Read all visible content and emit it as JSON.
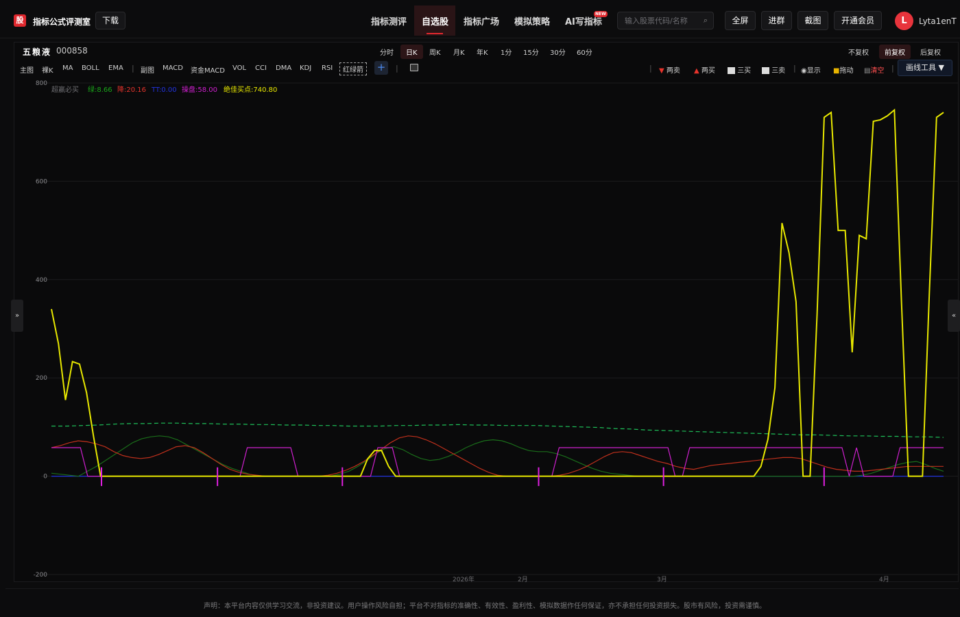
{
  "header": {
    "logo_text": "股",
    "app_name": "指标公式评测室",
    "download_label": "下载",
    "nav": [
      {
        "label": "指标测评",
        "active": false
      },
      {
        "label": "自选股",
        "active": true
      },
      {
        "label": "指标广场",
        "active": false
      },
      {
        "label": "模拟策略",
        "active": false
      },
      {
        "label": "AI写指标",
        "active": false,
        "badge": "NEW"
      }
    ],
    "search_placeholder": "输入股票代码/名称",
    "fullscreen_label": "全屏",
    "join_group_label": "进群",
    "screenshot_label": "截图",
    "vip_label": "开通会员",
    "avatar_letter": "L",
    "username": "Lyta1enT"
  },
  "stock": {
    "name": "五粮液",
    "code": "000858"
  },
  "periods": [
    "分时",
    "日K",
    "周K",
    "月K",
    "年K",
    "1分",
    "15分",
    "30分",
    "60分"
  ],
  "selected_period": "日K",
  "adjust": [
    "不复权",
    "前复权",
    "后复权"
  ],
  "selected_adjust": "前复权",
  "indicators_main": [
    "主图",
    "裸K",
    "MA",
    "BOLL",
    "EMA"
  ],
  "indicators_sub": [
    "副图",
    "MACD",
    "资金MACD",
    "VOL",
    "CCI",
    "DMA",
    "KDJ",
    "RSI",
    "红绿箭"
  ],
  "tools": [
    {
      "label": "两卖",
      "icon": "down-triangle-icon",
      "color": "#e8342c"
    },
    {
      "label": "两买",
      "icon": "up-triangle-icon",
      "color": "#e8342c"
    },
    {
      "label": "三买",
      "icon": "trend-up-icon",
      "color": "#cfcfcf"
    },
    {
      "label": "三卖",
      "icon": "trend-down-icon",
      "color": "#cfcfcf"
    },
    {
      "label": "显示",
      "icon": "eye-icon",
      "color": "#cfcfcf"
    },
    {
      "label": "拖动",
      "icon": "lock-icon",
      "color": "#cfcfcf"
    },
    {
      "label": "清空",
      "icon": "trash-icon",
      "color": "#ff5050"
    }
  ],
  "draw_tools_label": "画线工具 ▼",
  "legend": [
    {
      "label": "超赢必买",
      "color": "#6e6e72"
    },
    {
      "label": "绿:8.66",
      "color": "#1aa81a"
    },
    {
      "label": "降:20.16",
      "color": "#e8342c"
    },
    {
      "label": "TT:0.00",
      "color": "#2233dd"
    },
    {
      "label": "操盘:58.00",
      "color": "#d020d0"
    },
    {
      "label": "绝佳买点:740.80",
      "color": "#e8e800"
    }
  ],
  "chart_data": {
    "type": "line",
    "y_ticks": [
      800,
      600,
      400,
      200,
      0,
      -200
    ],
    "ylim": [
      -200,
      800
    ],
    "x_labels": [
      "2026年",
      "2月",
      "3月",
      "4月"
    ],
    "grid": true,
    "series": [
      {
        "name": "绝佳买点",
        "color": "#e8e800",
        "values": [
          340,
          270,
          155,
          233,
          228,
          170,
          80,
          0,
          0,
          0,
          0,
          0,
          0,
          0,
          0,
          0,
          0,
          0,
          0,
          0,
          0,
          0,
          0,
          0,
          0,
          0,
          0,
          0,
          0,
          0,
          0,
          0,
          0,
          0,
          0,
          0,
          0,
          0,
          0,
          0,
          0,
          0,
          0,
          0,
          0,
          35,
          52,
          52,
          20,
          0,
          0,
          0,
          0,
          0,
          0,
          0,
          0,
          0,
          0,
          0,
          0,
          0,
          0,
          0,
          0,
          0,
          0,
          0,
          0,
          0,
          0,
          0,
          0,
          0,
          0,
          0,
          0,
          0,
          0,
          0,
          0,
          0,
          0,
          0,
          0,
          0,
          0,
          0,
          0,
          0,
          0,
          0,
          0,
          0,
          0,
          0,
          0,
          0,
          0,
          0,
          0,
          20,
          75,
          180,
          515,
          455,
          355,
          0,
          0,
          330,
          730,
          740,
          500,
          500,
          252,
          490,
          483,
          722,
          725,
          733,
          745,
          360,
          0,
          0,
          0,
          380,
          730,
          740
        ]
      },
      {
        "name": "操盘",
        "color": "#d020d0",
        "values": [
          58,
          58,
          58,
          58,
          58,
          0,
          0,
          0,
          0,
          0,
          0,
          0,
          0,
          0,
          0,
          0,
          0,
          0,
          0,
          0,
          0,
          0,
          0,
          0,
          0,
          0,
          0,
          58,
          58,
          58,
          58,
          58,
          58,
          58,
          0,
          0,
          0,
          0,
          0,
          0,
          0,
          0,
          0,
          0,
          0,
          58,
          58,
          58,
          0,
          0,
          0,
          0,
          0,
          0,
          0,
          0,
          0,
          0,
          0,
          0,
          0,
          0,
          0,
          0,
          0,
          0,
          0,
          0,
          0,
          0,
          58,
          58,
          58,
          58,
          58,
          58,
          58,
          58,
          58,
          58,
          58,
          58,
          58,
          58,
          58,
          58,
          0,
          0,
          58,
          58,
          58,
          58,
          58,
          58,
          58,
          58,
          58,
          58,
          58,
          58,
          58,
          58,
          58,
          58,
          58,
          58,
          58,
          58,
          58,
          58,
          0,
          58,
          0,
          0,
          0,
          0,
          0,
          58,
          58,
          58,
          58,
          58,
          58,
          58
        ]
      },
      {
        "name": "降",
        "color": "#c0301c",
        "values": [
          58,
          62,
          68,
          72,
          70,
          66,
          60,
          50,
          42,
          38,
          36,
          38,
          44,
          52,
          60,
          62,
          58,
          48,
          36,
          24,
          14,
          8,
          4,
          2,
          0,
          0,
          0,
          0,
          0,
          0,
          0,
          2,
          6,
          12,
          20,
          30,
          42,
          55,
          68,
          78,
          82,
          80,
          74,
          66,
          56,
          46,
          36,
          26,
          16,
          8,
          2,
          0,
          0,
          0,
          0,
          0,
          0,
          2,
          6,
          12,
          20,
          30,
          40,
          48,
          50,
          48,
          42,
          36,
          30,
          26,
          20,
          16,
          14,
          18,
          22,
          24,
          26,
          28,
          30,
          32,
          34,
          36,
          38,
          38,
          36,
          30,
          24,
          18,
          14,
          12,
          10,
          10,
          12,
          14,
          16,
          18,
          20,
          20,
          20,
          20,
          20
        ]
      },
      {
        "name": "绿",
        "color": "#1a6e1a",
        "values": [
          6,
          4,
          2,
          0,
          10,
          20,
          32,
          44,
          56,
          68,
          76,
          80,
          82,
          80,
          74,
          64,
          54,
          44,
          34,
          24,
          16,
          10,
          4,
          0,
          0,
          0,
          0,
          0,
          0,
          0,
          0,
          0,
          4,
          10,
          20,
          32,
          46,
          56,
          60,
          54,
          44,
          36,
          32,
          34,
          40,
          48,
          58,
          66,
          72,
          74,
          72,
          66,
          58,
          52,
          50,
          50,
          46,
          40,
          32,
          24,
          16,
          10,
          6,
          4,
          2,
          0,
          0,
          0,
          0,
          0,
          0,
          0,
          0,
          0,
          0,
          0,
          0,
          0,
          0,
          0,
          0,
          0,
          0,
          0,
          0,
          0,
          0,
          0,
          0,
          0,
          2,
          6,
          12,
          18,
          24,
          28,
          30,
          24,
          16,
          10
        ]
      },
      {
        "name": "TT",
        "color": "#2233dd",
        "values": [
          0,
          0,
          0,
          0,
          0,
          0,
          0,
          0,
          0,
          0,
          0,
          0,
          0,
          0,
          0,
          0,
          0,
          0,
          0,
          0,
          0,
          0,
          0,
          0,
          0,
          0,
          0,
          0,
          0,
          0,
          0,
          0,
          0,
          0,
          0,
          0,
          0,
          0,
          0,
          0,
          0,
          0,
          0,
          0,
          0,
          0,
          0,
          0,
          0,
          0,
          0,
          0,
          0,
          0,
          0,
          0,
          0,
          0,
          0,
          0,
          0,
          0,
          0,
          0,
          0,
          0,
          0,
          0,
          0,
          0,
          0,
          0,
          0,
          0,
          0,
          0,
          0,
          0,
          0,
          0,
          0,
          0,
          0,
          0,
          0,
          0,
          0,
          0,
          0,
          0,
          0,
          0,
          0,
          0,
          0,
          0,
          0,
          0,
          0,
          0,
          0
        ]
      },
      {
        "name": "K",
        "color": "#1ec25a",
        "values": [
          102,
          102,
          103,
          104,
          106,
          107,
          107,
          108,
          108,
          107,
          107,
          106,
          106,
          105,
          105,
          104,
          104,
          103,
          103,
          102,
          102,
          102,
          103,
          103,
          104,
          104,
          105,
          104,
          104,
          103,
          103,
          103,
          102,
          101,
          100,
          99,
          97,
          96,
          94,
          93,
          92,
          91,
          90,
          89,
          88,
          87,
          86,
          85,
          84,
          84,
          83,
          82,
          82,
          81,
          81,
          80,
          80,
          79
        ]
      }
    ],
    "buy_marks": [
      1,
      14,
      28,
      50,
      64,
      82,
      100
    ]
  },
  "disclaimer": "声明：本平台内容仅供学习交流，非投资建议。用户操作风险自担；平台不对指标的准确性、有效性、盈利性、模拟数据作任何保证，亦不承担任何投资损失。股市有风险，投资需谨慎。"
}
